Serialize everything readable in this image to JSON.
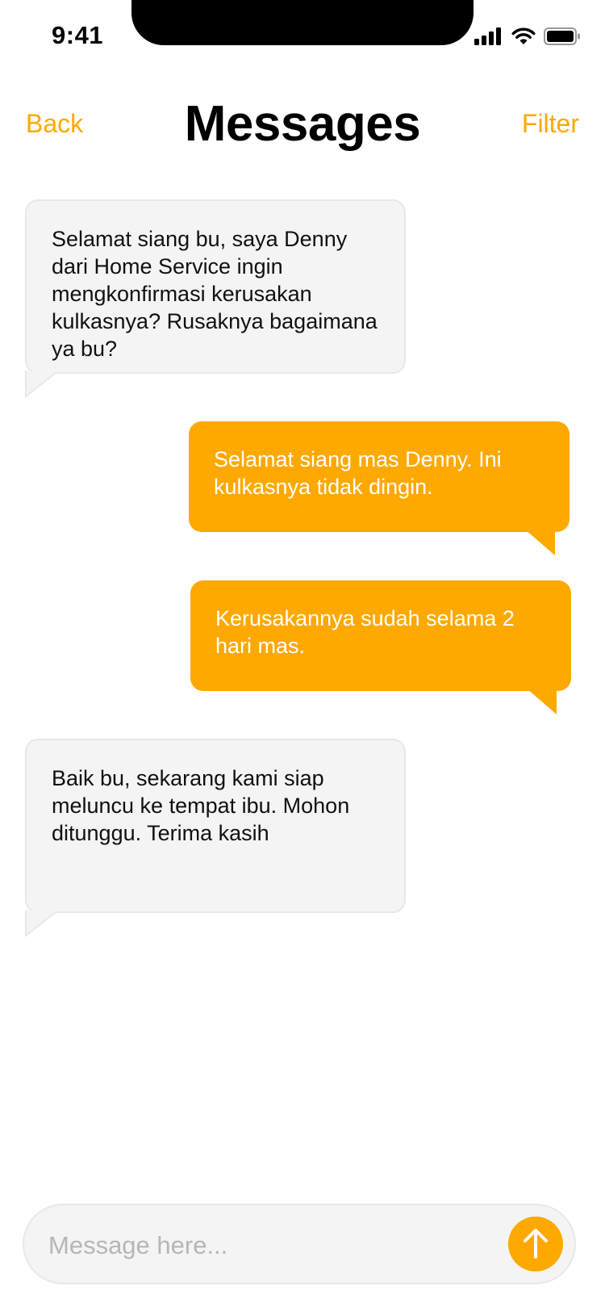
{
  "status_bar": {
    "time": "9:41"
  },
  "nav": {
    "back_label": "Back",
    "title": "Messages",
    "filter_label": "Filter"
  },
  "messages": [
    {
      "direction": "in",
      "text": "Selamat siang bu, saya Denny dari Home Service ingin mengkonfirmasi kerusakan kulkasnya? Rusaknya bagaimana ya bu?"
    },
    {
      "direction": "out",
      "text": "Selamat siang mas Denny. Ini kulkasnya tidak dingin."
    },
    {
      "direction": "out",
      "text": "Kerusakannya sudah selama 2 hari mas."
    },
    {
      "direction": "in",
      "text": "Baik bu, sekarang kami siap meluncu ke tempat ibu. Mohon ditunggu. Terima kasih"
    }
  ],
  "composer": {
    "placeholder": "Message here...",
    "value": ""
  },
  "icons": {
    "signal": "cellular-signal-icon",
    "wifi": "wifi-icon",
    "battery": "battery-icon",
    "send": "arrow-up-icon"
  },
  "colors": {
    "accent": "#FFA800",
    "incoming_bubble": "#F4F4F4",
    "outgoing_text": "#FFFFFF"
  }
}
